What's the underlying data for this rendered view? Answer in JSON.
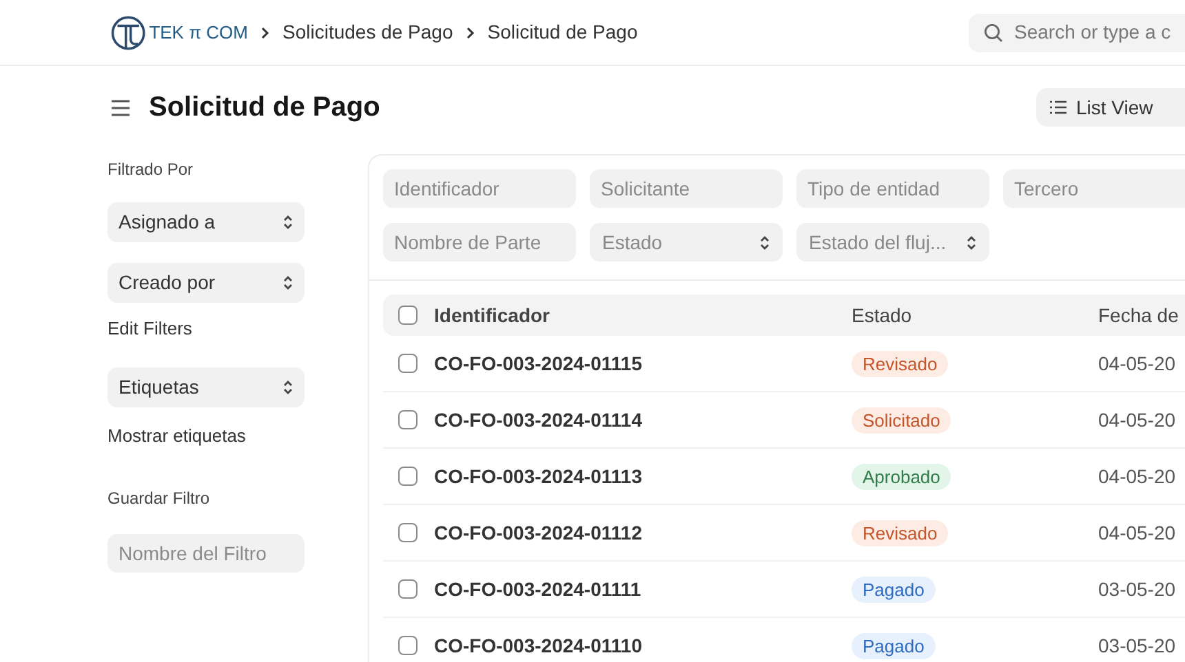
{
  "header": {
    "logo_text": "TEK π COM",
    "breadcrumbs": [
      "Solicitudes de Pago",
      "Solicitud de Pago"
    ],
    "search": {
      "placeholder": "Search or type a c"
    }
  },
  "page": {
    "title": "Solicitud de Pago",
    "view_button": "List View"
  },
  "sidebar": {
    "heading": "Filtrado Por",
    "selects": [
      "Asignado a",
      "Creado por"
    ],
    "edit_filters": "Edit Filters",
    "tags_select": "Etiquetas",
    "show_tags": "Mostrar etiquetas",
    "save_heading": "Guardar Filtro",
    "filter_name": {
      "placeholder": "Nombre del Filtro"
    }
  },
  "filters": [
    {
      "kind": "input",
      "placeholder": "Identificador"
    },
    {
      "kind": "input",
      "placeholder": "Solicitante"
    },
    {
      "kind": "input",
      "placeholder": "Tipo de entidad"
    },
    {
      "kind": "input",
      "placeholder": "Tercero"
    },
    {
      "kind": "input",
      "placeholder": "Nombre de Parte"
    },
    {
      "kind": "select",
      "placeholder": "Estado"
    },
    {
      "kind": "select",
      "placeholder": "Estado del fluj..."
    }
  ],
  "table": {
    "columns": [
      "Identificador",
      "Estado",
      "Fecha de"
    ],
    "select_all_checked": false,
    "rows": [
      {
        "id": "CO-FO-003-2024-01115",
        "status": "Revisado",
        "color": "#c4552b",
        "date": "04-05-20",
        "checked": false
      },
      {
        "id": "CO-FO-003-2024-01114",
        "status": "Solicitado",
        "color": "#c4552b",
        "date": "04-05-20",
        "checked": false
      },
      {
        "id": "CO-FO-003-2024-01113",
        "status": "Aprobado",
        "color": "#2f7d4a",
        "date": "04-05-20",
        "checked": false
      },
      {
        "id": "CO-FO-003-2024-01112",
        "status": "Revisado",
        "color": "#c4552b",
        "date": "04-05-20",
        "checked": false
      },
      {
        "id": "CO-FO-003-2024-01111",
        "status": "Pagado",
        "color": "#2f6bbf",
        "date": "03-05-20",
        "checked": false
      },
      {
        "id": "CO-FO-003-2024-01110",
        "status": "Pagado",
        "color": "#2f6bbf",
        "date": "03-05-20",
        "checked": false
      }
    ]
  }
}
